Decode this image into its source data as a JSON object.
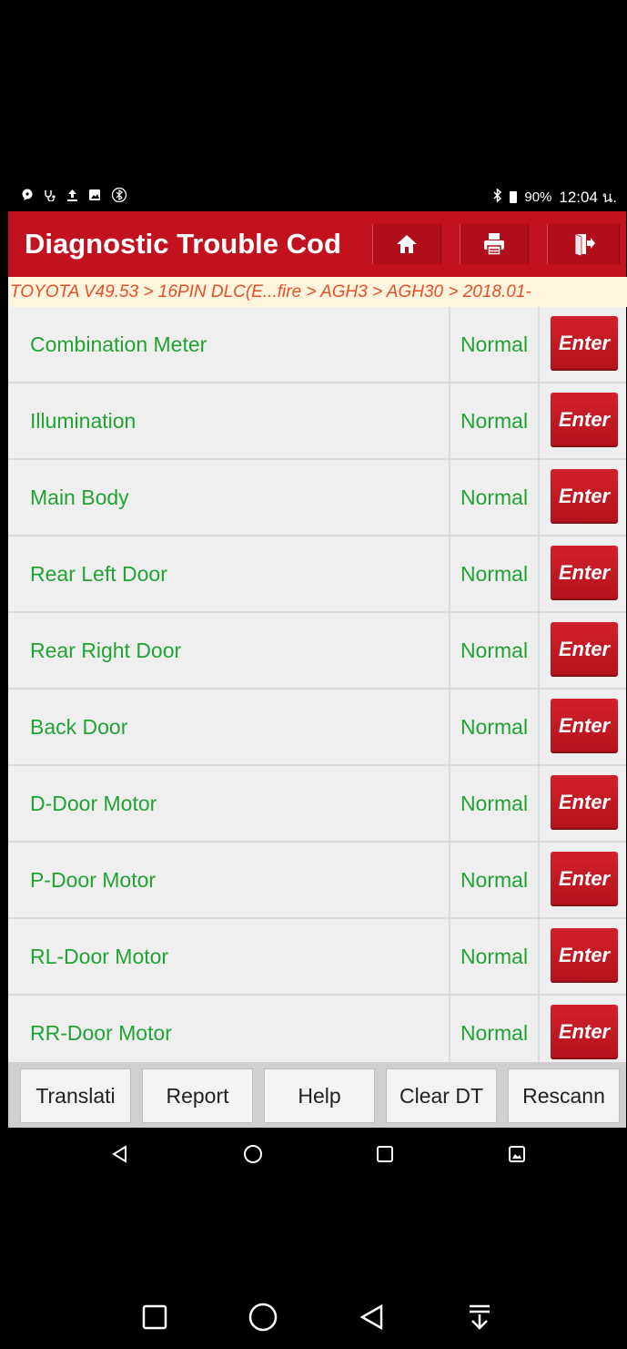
{
  "status_bar": {
    "battery_percent": "90%",
    "time": "12:04 น."
  },
  "header": {
    "title": "Diagnostic Trouble Cod",
    "home_icon": "home-icon",
    "print_icon": "printer-icon",
    "exit_icon": "exit-icon"
  },
  "breadcrumb": "TOYOTA V49.53 > 16PIN DLC(E...fire > AGH3 > AGH30 > 2018.01-",
  "systems": [
    {
      "name": "Combination Meter",
      "status": "Normal",
      "action": "Enter"
    },
    {
      "name": "Illumination",
      "status": "Normal",
      "action": "Enter"
    },
    {
      "name": "Main Body",
      "status": "Normal",
      "action": "Enter"
    },
    {
      "name": "Rear Left Door",
      "status": "Normal",
      "action": "Enter"
    },
    {
      "name": "Rear Right Door",
      "status": "Normal",
      "action": "Enter"
    },
    {
      "name": "Back Door",
      "status": "Normal",
      "action": "Enter"
    },
    {
      "name": "D-Door Motor",
      "status": "Normal",
      "action": "Enter"
    },
    {
      "name": "P-Door Motor",
      "status": "Normal",
      "action": "Enter"
    },
    {
      "name": "RL-Door Motor",
      "status": "Normal",
      "action": "Enter"
    },
    {
      "name": "RR-Door Motor",
      "status": "Normal",
      "action": "Enter"
    }
  ],
  "toolbar": {
    "translate": "Translati",
    "report": "Report",
    "help": "Help",
    "clear": "Clear DT",
    "rescan": "Rescann"
  },
  "colors": {
    "header_red": "#c2121f",
    "ok_green": "#21a334",
    "breadcrumb_orange": "#e2502a"
  }
}
